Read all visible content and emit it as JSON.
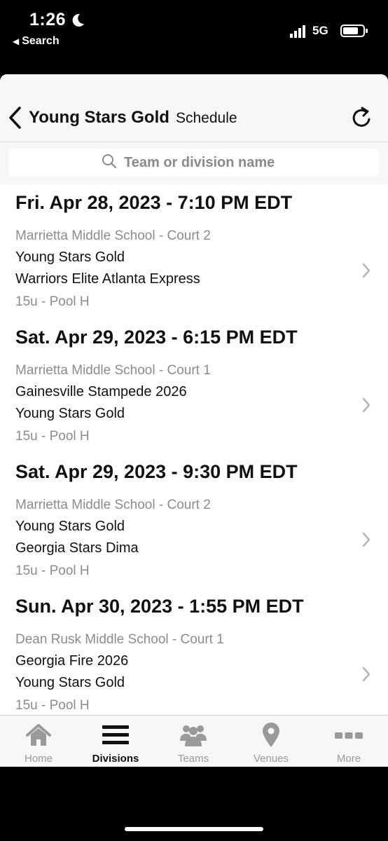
{
  "status": {
    "time": "1:26",
    "back_label": "Search",
    "network": "5G"
  },
  "nav": {
    "team": "Young Stars Gold",
    "title": "Schedule"
  },
  "search": {
    "placeholder": "Team or division name"
  },
  "games": [
    {
      "date": "Fri. Apr 28, 2023 - 7:10 PM EDT",
      "venue": "Marrietta Middle School - Court 2",
      "team1": "Young Stars Gold",
      "team2": "Warriors Elite Atlanta Express",
      "pool": "15u - Pool H"
    },
    {
      "date": "Sat. Apr 29, 2023 - 6:15 PM EDT",
      "venue": "Marrietta Middle School - Court 1",
      "team1": "Gainesville Stampede 2026",
      "team2": "Young Stars Gold",
      "pool": "15u - Pool H"
    },
    {
      "date": "Sat. Apr 29, 2023 - 9:30 PM EDT",
      "venue": "Marrietta Middle School - Court 2",
      "team1": "Young Stars Gold",
      "team2": "Georgia Stars Dima",
      "pool": "15u - Pool H"
    },
    {
      "date": "Sun. Apr 30, 2023 - 1:55 PM EDT",
      "venue": "Dean Rusk Middle School - Court 1",
      "team1": "Georgia Fire 2026",
      "team2": "Young Stars Gold",
      "pool": "15u - Pool H"
    }
  ],
  "tabs": [
    {
      "label": "Home",
      "icon": "home-icon",
      "active": false
    },
    {
      "label": "Divisions",
      "icon": "menu-icon",
      "active": true
    },
    {
      "label": "Teams",
      "icon": "people-icon",
      "active": false
    },
    {
      "label": "Venues",
      "icon": "map-pin-icon",
      "active": false
    },
    {
      "label": "More",
      "icon": "more-icon",
      "active": false
    }
  ],
  "colors": {
    "active_tab": "#111111",
    "inactive_tab": "#9a9a9a",
    "secondary_text": "#8c8c8c"
  }
}
